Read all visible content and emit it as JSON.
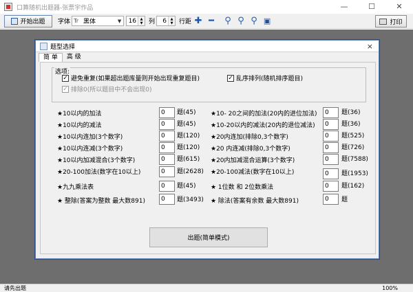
{
  "window": {
    "title": "口算随机出题器-张票宇作品",
    "minimize": "—",
    "maximize": "☐",
    "close": "✕"
  },
  "toolbar": {
    "start_label": "开始出题",
    "font_label": "字体",
    "font_value": "黑体",
    "size_value": "16",
    "cols_label": "列",
    "cols_value": "6",
    "linespacing_label": "行距",
    "print_label": "打印"
  },
  "dialog": {
    "title": "题型选择",
    "close": "×",
    "tabs": [
      "简 单",
      "高 级"
    ],
    "options": {
      "legend": "选项:",
      "avoid_repeat": "避免重复(如果超出题库量则开始出现重复题目)",
      "shuffle": "乱序排列(随机排序题目)",
      "exclude_zero": "排除0(所以题目中不会出现0)"
    },
    "left_items": [
      {
        "label": "★10以内的加法",
        "value": "0",
        "count": "题(45)"
      },
      {
        "label": "★10以内的减法",
        "value": "0",
        "count": "题(45)"
      },
      {
        "label": "★10以内连加(3个数字)",
        "value": "0",
        "count": "题(120)"
      },
      {
        "label": "★10以内连减(3个数字)",
        "value": "0",
        "count": "题(120)"
      },
      {
        "label": "★10以内加减混合(3个数字)",
        "value": "0",
        "count": "题(615)"
      },
      {
        "label": "★20-100加法(数字在10以上)",
        "value": "0",
        "count": "题(2628)"
      },
      {
        "label": "★九九乘法表",
        "value": "0",
        "count": "题(45)"
      },
      {
        "label": "★ 整除(答案为整数 最大数891)",
        "value": "0",
        "count": "题(3493)"
      }
    ],
    "right_items": [
      {
        "label": "★10- 20之间的加法(20内的进位加法)",
        "value": "0",
        "count": "题(36)"
      },
      {
        "label": "★10-20以内的减法(20内的退位减法)",
        "value": "0",
        "count": "题(36)"
      },
      {
        "label": "★20内连加(排除0,3个数字)",
        "value": "0",
        "count": "题(525)"
      },
      {
        "label": "★20 内连减(排除0,3个数字)",
        "value": "0",
        "count": "题(726)"
      },
      {
        "label": "★20内加减混合运算(3个数字)",
        "value": "0",
        "count": "题(7588)"
      },
      {
        "label": "★20-100减法(数字在10以上)",
        "value": "0",
        "count": "题(1953)"
      },
      {
        "label": "★ 1位数 和 2位数乘法",
        "value": "0",
        "count": "题(162)"
      },
      {
        "label": "★ 除法(答案有余数 最大数891)",
        "value": "0",
        "count": "题"
      }
    ],
    "generate_label": "出题(简单模式)"
  },
  "status": {
    "message": "请先出题",
    "zoom": "100%"
  }
}
